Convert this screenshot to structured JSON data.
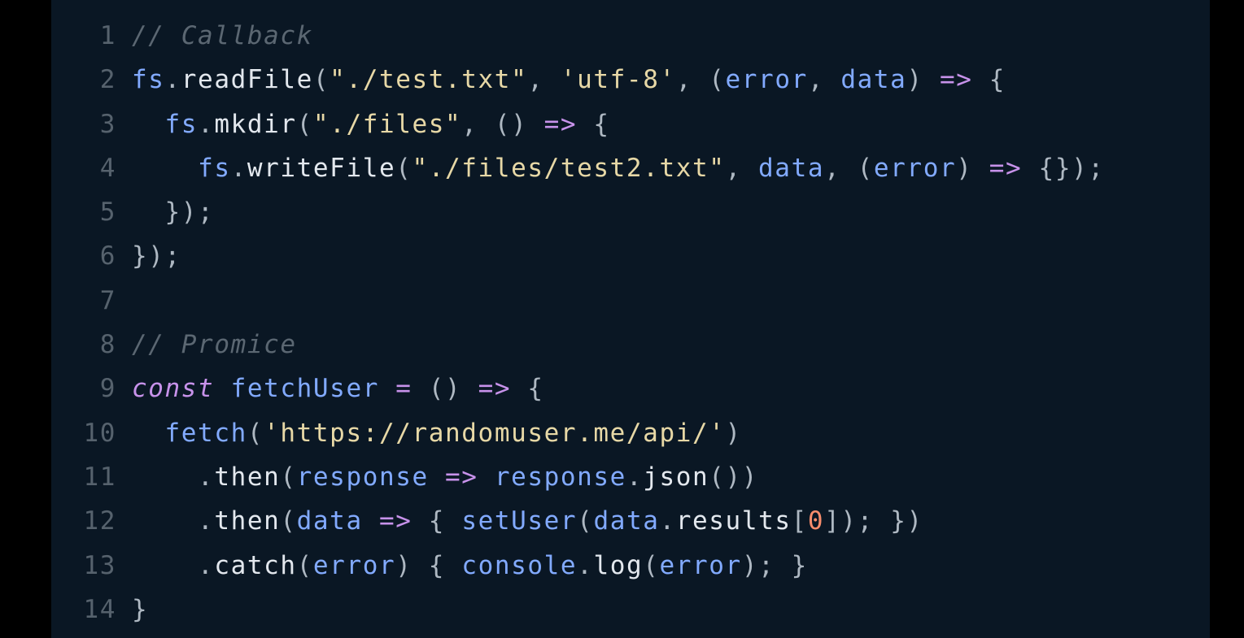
{
  "colors": {
    "background": "#0a1724",
    "outer": "#000000",
    "line_number": "#56626d",
    "comment": "#5b6772",
    "identifier_blue": "#82aaff",
    "keyword_purple": "#c792ea",
    "string": "#e7d8a6",
    "number": "#f78c6c",
    "text": "#e3e8ee"
  },
  "code": {
    "lines": [
      {
        "number": "1",
        "tokens": [
          {
            "t": "// Callback",
            "c": "comment"
          }
        ]
      },
      {
        "number": "2",
        "tokens": [
          {
            "t": "fs",
            "c": "obj"
          },
          {
            "t": ".",
            "c": "punc"
          },
          {
            "t": "readFile",
            "c": "fn"
          },
          {
            "t": "(",
            "c": "punc"
          },
          {
            "t": "\"./test.txt\"",
            "c": "str"
          },
          {
            "t": ", ",
            "c": "punc"
          },
          {
            "t": "'utf-8'",
            "c": "str"
          },
          {
            "t": ", (",
            "c": "punc"
          },
          {
            "t": "error",
            "c": "param"
          },
          {
            "t": ", ",
            "c": "punc"
          },
          {
            "t": "data",
            "c": "param"
          },
          {
            "t": ") ",
            "c": "punc"
          },
          {
            "t": "=>",
            "c": "op"
          },
          {
            "t": " {",
            "c": "punc"
          }
        ]
      },
      {
        "number": "3",
        "tokens": [
          {
            "t": "  ",
            "c": "punc"
          },
          {
            "t": "fs",
            "c": "obj"
          },
          {
            "t": ".",
            "c": "punc"
          },
          {
            "t": "mkdir",
            "c": "fn"
          },
          {
            "t": "(",
            "c": "punc"
          },
          {
            "t": "\"./files\"",
            "c": "str"
          },
          {
            "t": ", () ",
            "c": "punc"
          },
          {
            "t": "=>",
            "c": "op"
          },
          {
            "t": " {",
            "c": "punc"
          }
        ]
      },
      {
        "number": "4",
        "tokens": [
          {
            "t": "    ",
            "c": "punc"
          },
          {
            "t": "fs",
            "c": "obj"
          },
          {
            "t": ".",
            "c": "punc"
          },
          {
            "t": "writeFile",
            "c": "fn"
          },
          {
            "t": "(",
            "c": "punc"
          },
          {
            "t": "\"./files/test2.txt\"",
            "c": "str"
          },
          {
            "t": ", ",
            "c": "punc"
          },
          {
            "t": "data",
            "c": "param"
          },
          {
            "t": ", (",
            "c": "punc"
          },
          {
            "t": "error",
            "c": "param"
          },
          {
            "t": ") ",
            "c": "punc"
          },
          {
            "t": "=>",
            "c": "op"
          },
          {
            "t": " {});",
            "c": "punc"
          }
        ]
      },
      {
        "number": "5",
        "tokens": [
          {
            "t": "  });",
            "c": "punc"
          }
        ]
      },
      {
        "number": "6",
        "tokens": [
          {
            "t": "});",
            "c": "punc"
          }
        ]
      },
      {
        "number": "7",
        "tokens": []
      },
      {
        "number": "8",
        "tokens": [
          {
            "t": "// Promice",
            "c": "comment"
          }
        ]
      },
      {
        "number": "9",
        "tokens": [
          {
            "t": "const",
            "c": "kw"
          },
          {
            "t": " ",
            "c": "punc"
          },
          {
            "t": "fetchUser",
            "c": "var"
          },
          {
            "t": " ",
            "c": "punc"
          },
          {
            "t": "=",
            "c": "op"
          },
          {
            "t": " () ",
            "c": "punc"
          },
          {
            "t": "=>",
            "c": "op"
          },
          {
            "t": " {",
            "c": "punc"
          }
        ]
      },
      {
        "number": "10",
        "tokens": [
          {
            "t": "  ",
            "c": "punc"
          },
          {
            "t": "fetch",
            "c": "var"
          },
          {
            "t": "(",
            "c": "punc"
          },
          {
            "t": "'https://randomuser.me/api/'",
            "c": "str"
          },
          {
            "t": ")",
            "c": "punc"
          }
        ]
      },
      {
        "number": "11",
        "tokens": [
          {
            "t": "    .",
            "c": "punc"
          },
          {
            "t": "then",
            "c": "fn"
          },
          {
            "t": "(",
            "c": "punc"
          },
          {
            "t": "response",
            "c": "param"
          },
          {
            "t": " ",
            "c": "punc"
          },
          {
            "t": "=>",
            "c": "op"
          },
          {
            "t": " ",
            "c": "punc"
          },
          {
            "t": "response",
            "c": "param"
          },
          {
            "t": ".",
            "c": "punc"
          },
          {
            "t": "json",
            "c": "fn"
          },
          {
            "t": "())",
            "c": "punc"
          }
        ]
      },
      {
        "number": "12",
        "tokens": [
          {
            "t": "    .",
            "c": "punc"
          },
          {
            "t": "then",
            "c": "fn"
          },
          {
            "t": "(",
            "c": "punc"
          },
          {
            "t": "data",
            "c": "param"
          },
          {
            "t": " ",
            "c": "punc"
          },
          {
            "t": "=>",
            "c": "op"
          },
          {
            "t": " { ",
            "c": "punc"
          },
          {
            "t": "setUser",
            "c": "var"
          },
          {
            "t": "(",
            "c": "punc"
          },
          {
            "t": "data",
            "c": "param"
          },
          {
            "t": ".",
            "c": "punc"
          },
          {
            "t": "results",
            "c": "fn"
          },
          {
            "t": "[",
            "c": "punc"
          },
          {
            "t": "0",
            "c": "num"
          },
          {
            "t": "]); })",
            "c": "punc"
          }
        ]
      },
      {
        "number": "13",
        "tokens": [
          {
            "t": "    .",
            "c": "punc"
          },
          {
            "t": "catch",
            "c": "fn"
          },
          {
            "t": "(",
            "c": "punc"
          },
          {
            "t": "error",
            "c": "param"
          },
          {
            "t": ") { ",
            "c": "punc"
          },
          {
            "t": "console",
            "c": "var"
          },
          {
            "t": ".",
            "c": "punc"
          },
          {
            "t": "log",
            "c": "fn"
          },
          {
            "t": "(",
            "c": "punc"
          },
          {
            "t": "error",
            "c": "param"
          },
          {
            "t": "); }",
            "c": "punc"
          }
        ]
      },
      {
        "number": "14",
        "tokens": [
          {
            "t": "}",
            "c": "punc"
          }
        ]
      }
    ]
  }
}
